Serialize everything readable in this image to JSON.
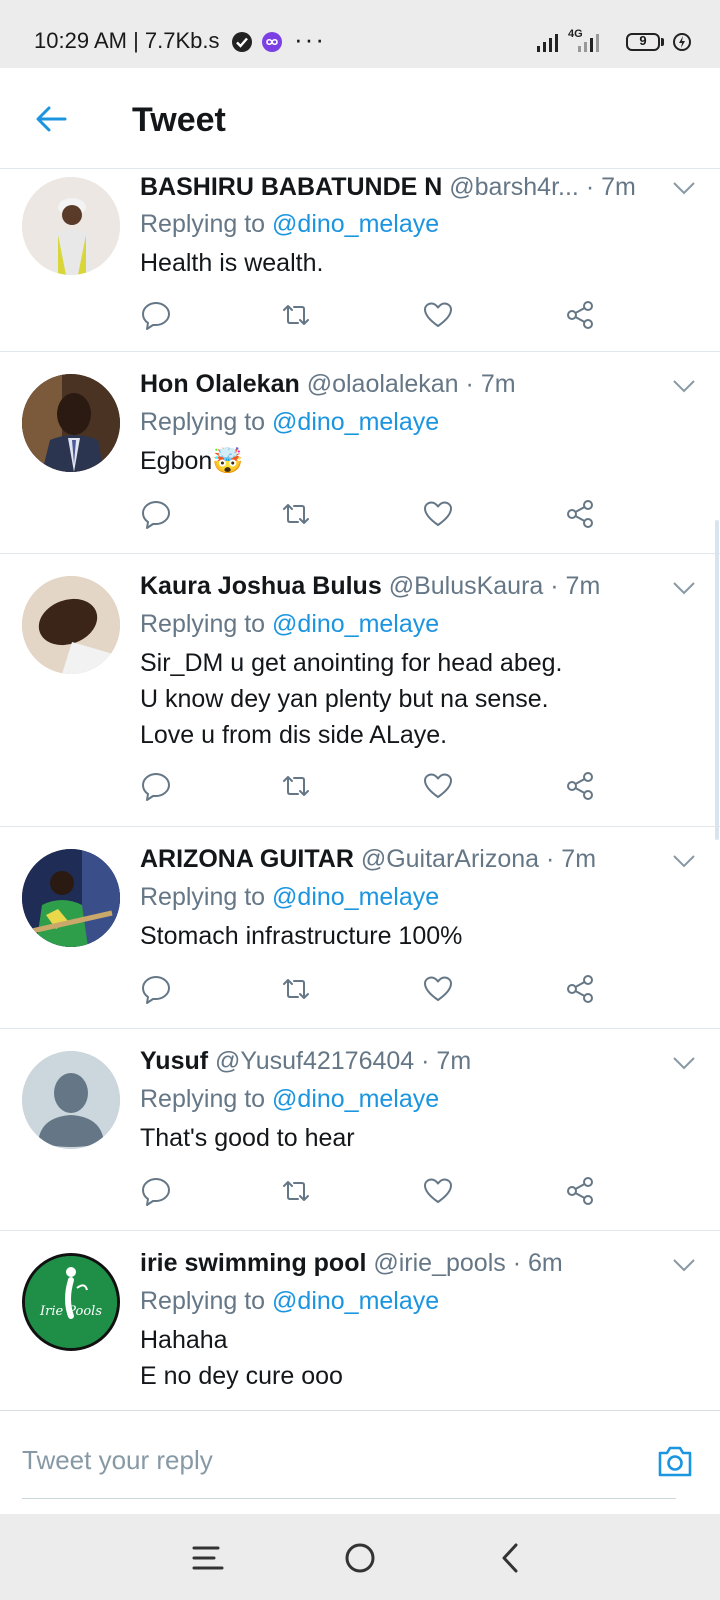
{
  "status_bar": {
    "time": "10:29 AM | 7.7Kb.s",
    "network": "4G",
    "battery": "9",
    "more": "···"
  },
  "header": {
    "title": "Tweet",
    "back_icon": "arrow-left-icon"
  },
  "colors": {
    "accent": "#1b95e0",
    "text_primary": "#14171a",
    "text_secondary": "#657786",
    "divider": "#e1e8ed"
  },
  "tweets": [
    {
      "name": "BASHIRU BABATUNDE N",
      "handle": "@barsh4r...",
      "time": "· 7m",
      "replying_label": "Replying to",
      "mention": "@dino_melaye",
      "lines": [
        "Health is wealth."
      ]
    },
    {
      "name": "Hon Olalekan",
      "handle": "@olaolalekan",
      "time": "· 7m",
      "replying_label": "Replying to",
      "mention": "@dino_melaye",
      "lines": [
        "Egbon🤯"
      ]
    },
    {
      "name": "Kaura Joshua Bulus",
      "handle": "@BulusKaura",
      "time": "· 7m",
      "replying_label": "Replying to",
      "mention": "@dino_melaye",
      "lines": [
        "Sir_DM u get anointing for head abeg.",
        "U know dey yan plenty but na sense.",
        "Love u from dis side ALaye."
      ]
    },
    {
      "name": "ARIZONA GUITAR",
      "handle": "@GuitarArizona",
      "time": "· 7m",
      "replying_label": "Replying to",
      "mention": "@dino_melaye",
      "lines": [
        "Stomach infrastructure 100%"
      ]
    },
    {
      "name": "Yusuf",
      "handle": "@Yusuf42176404",
      "time": "· 7m",
      "replying_label": "Replying to",
      "mention": "@dino_melaye",
      "lines": [
        "That's good to hear"
      ]
    },
    {
      "name": "irie swimming pool",
      "handle": "@irie_pools",
      "time": "· 6m",
      "replying_label": "Replying to",
      "mention": "@dino_melaye",
      "lines": [
        "Hahaha",
        "E no dey cure ooo"
      ],
      "avatar_text": "Irie Pools"
    }
  ],
  "actions": [
    "reply-icon",
    "retweet-icon",
    "like-icon",
    "share-icon"
  ],
  "reply_bar": {
    "placeholder": "Tweet your reply",
    "camera_icon": "camera-icon"
  },
  "nav_bar": [
    "menu-icon",
    "home-circle-icon",
    "back-chevron-icon"
  ]
}
